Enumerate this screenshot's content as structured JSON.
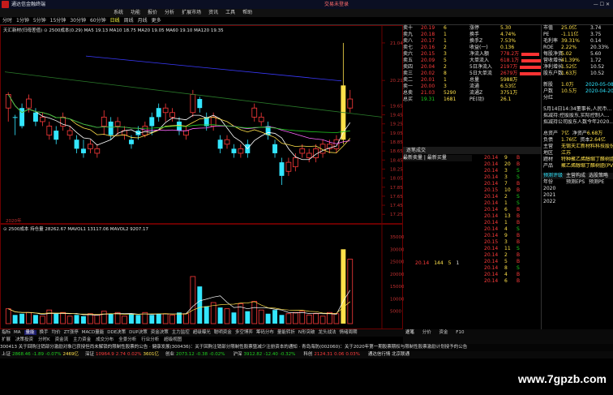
{
  "title": "通达信金融终端",
  "title_right": "交易未登录",
  "menu": [
    "系统",
    "功能",
    "报价",
    "分析",
    "扩展市场",
    "资讯",
    "工具",
    "帮助"
  ],
  "toolbar": [
    "分时",
    "1分钟",
    "5分钟",
    "15分钟",
    "30分钟",
    "60分钟",
    "日线",
    "周线",
    "月线",
    "更多"
  ],
  "toolbar_selected": "日线",
  "main_legend": "天汇新材(归母差值) ⊙ 2500成本(0.29)  MA5 19.13  MA10 18.75  MA20 19.05  MA60 19.10  MA120 19.35",
  "vol_legend": "⊙ 2500成本 持仓量 28262.67  MAVOL1 13117.06  MAVOL2 9207.17",
  "price_axis": [
    "21.04",
    "20.21",
    "19.65",
    "19.45",
    "19.25",
    "19.05",
    "18.85",
    "18.65",
    "18.45",
    "18.25",
    "18.05",
    "17.85",
    "17.65",
    "17.45",
    "17.25"
  ],
  "vol_axis": [
    "35000",
    "30000",
    "25000",
    "20000",
    "15000",
    "10000",
    "5000"
  ],
  "date_label": "2020年",
  "order_book": {
    "sells": [
      {
        "label": "卖十",
        "price": "20.19",
        "vol": "6"
      },
      {
        "label": "卖九",
        "price": "20.18",
        "vol": "1"
      },
      {
        "label": "卖八",
        "price": "20.17",
        "vol": "1"
      },
      {
        "label": "卖七",
        "price": "20.16",
        "vol": "2"
      },
      {
        "label": "卖六",
        "price": "20.15",
        "vol": "3"
      },
      {
        "label": "卖五",
        "price": "20.09",
        "vol": "5"
      },
      {
        "label": "卖四",
        "price": "20.04",
        "vol": "2"
      },
      {
        "label": "卖三",
        "price": "20.02",
        "vol": "8"
      },
      {
        "label": "卖二",
        "price": "20.01",
        "vol": "1"
      },
      {
        "label": "卖一",
        "price": "20.00",
        "vol": "3"
      }
    ],
    "totals": {
      "label": "总卖",
      "value": "21.03",
      "extra": "5290"
    },
    "buys_total": {
      "label": "总买",
      "value": "19.31",
      "extra": "1681"
    }
  },
  "stats": [
    {
      "k": "涨停",
      "v": "5.30"
    },
    {
      "k": "换手",
      "v": "4.74%"
    },
    {
      "k": "换手Z",
      "v": "7.53%"
    },
    {
      "k": "收益(一)",
      "v": "0.136"
    },
    {
      "k": "净流入额",
      "v": "778.2万"
    },
    {
      "k": "大单流入",
      "v": "618.1万"
    },
    {
      "k": "5日净流入",
      "v": "2197万"
    },
    {
      "k": "5日大单流",
      "v": "2679万"
    }
  ],
  "stats_right": [
    {
      "k": "总量",
      "v": "5988万"
    },
    {
      "k": "流通",
      "v": "6.53亿"
    },
    {
      "k": "流通Z",
      "v": "3751万"
    },
    {
      "k": "PE(动)",
      "v": "26.1"
    }
  ],
  "quote_panel": {
    "header": "逐笔成交",
    "ladder_header": "最新卖量 | 最新买量",
    "ladder_rows": [
      {
        "p": "20.14",
        "v": "9",
        "d": "B"
      },
      {
        "p": "20.14",
        "v": "20",
        "d": "B"
      },
      {
        "p": "20.14",
        "v": "3",
        "d": "S"
      },
      {
        "p": "20.14",
        "v": "3",
        "d": "S"
      },
      {
        "p": "20.14",
        "v": "7",
        "d": "B"
      },
      {
        "p": "20.15",
        "v": "10",
        "d": "B"
      },
      {
        "p": "20.14",
        "v": "2",
        "d": "S"
      },
      {
        "p": "20.14",
        "v": "1",
        "d": "S"
      },
      {
        "p": "20.14",
        "v": "6",
        "d": "B"
      },
      {
        "p": "20.14",
        "v": "13",
        "d": "B"
      },
      {
        "p": "20.14",
        "v": "1",
        "d": "B"
      },
      {
        "p": "20.14",
        "v": "4",
        "d": "S"
      },
      {
        "p": "20.14",
        "v": "9",
        "d": "B"
      },
      {
        "p": "20.15",
        "v": "3",
        "d": "B"
      },
      {
        "p": "20.14",
        "v": "11",
        "d": "S"
      },
      {
        "p": "20.14",
        "v": "2",
        "d": "B"
      },
      {
        "p": "20.14",
        "v": "5",
        "d": "B"
      },
      {
        "p": "20.14",
        "v": "8",
        "d": "S"
      },
      {
        "p": "20.14",
        "v": "4",
        "d": "B"
      },
      {
        "p": "20.14",
        "v": "6",
        "d": "B"
      }
    ],
    "buy_sell_row": {
      "b": "20.14",
      "v1": "144",
      "v2": "5",
      "extra": "1"
    }
  },
  "fundamentals": [
    {
      "k": "市值",
      "v": "25.0亿",
      "k2": "股本",
      "v2": "3.74"
    },
    {
      "k": "PE",
      "v": "-1.11亿",
      "k2": "流通",
      "v2": "3.75"
    },
    {
      "k": "毛利率",
      "v": "39.31%",
      "k2": "净利",
      "v2": "0.14"
    },
    {
      "k": "ROE",
      "v": "2.22%",
      "k2": "负债",
      "v2": "20.33%"
    },
    {
      "k": "每股净资",
      "v": "5.02",
      "k2": "",
      "v2": "5.60"
    },
    {
      "k": "营收增长",
      "v": "41.39%",
      "k2": "",
      "v2": "1.72"
    },
    {
      "k": "净利增长",
      "v": "1.52亿",
      "k2": "",
      "v2": "10.52"
    },
    {
      "k": "股东户数",
      "v": "1.63万",
      "k2": "",
      "v2": "10.52"
    }
  ],
  "events": {
    "dates": [
      "2020-05-08",
      "2020-04-20"
    ],
    "items": [
      "新股",
      "户数",
      "分红"
    ],
    "vals": [
      "1.0万",
      "10.5万"
    ]
  },
  "notes": [
    "5月14日14:34董事长,人民币...",
    "拟减持:控股股东,实际控制人...",
    "拟减持公司股东人数今年2020..."
  ],
  "financial": {
    "rows": [
      {
        "k": "总资产",
        "v": "7亿",
        "k2": "净资产",
        "v2": "6.68万"
      },
      {
        "k": "负债",
        "v": "1.76亿",
        "k2": "资本",
        "v2": "2.64亿"
      },
      {
        "k": "主营",
        "v": "无锡天汇新材料科技股份..."
      },
      {
        "k": "地区",
        "v": "江苏"
      },
      {
        "k": "题材",
        "v": "特种聚乙烯醇缩丁醛树脂..."
      },
      {
        "k": "产品",
        "v": "聚乙烯醇缩丁醛树脂(PVB)..."
      }
    ],
    "tabs": [
      "预测评级",
      "主营构成",
      "选股策略"
    ],
    "years_header": [
      "年份",
      "预测EPS",
      "预测PE"
    ],
    "years": [
      "2020",
      "2021",
      "2022"
    ]
  },
  "tabs_bottom": [
    "指标",
    "MA",
    "量能",
    "换手",
    "均价",
    "ZT涨停",
    "MACD量能",
    "DDE决策",
    "DUP决策",
    "资金决策",
    "主力监控",
    "超级曝光",
    "聪明资金",
    "多空博弈",
    "筹码分布",
    "量能转折",
    "N形突破",
    "龙头战法",
    "情绪周期"
  ],
  "tabs_bottom_selected": "量能",
  "tabs2": [
    "扩展",
    "决策投资",
    "分时K",
    "资金流",
    "主力资金",
    "成交分布",
    "全景分析",
    "行业分析",
    "超级视图"
  ],
  "news": "300413  关于回购注销部分激励对象已获授但尚未解锁的限制性股票的公告  ·  健康发展(300436)：关于回购注销部分限制性股票暨减少注册资本的通知  ·  青岛海防(002060)：关于2020年第一期股票期权与限制性股票激励计划授予的公告",
  "status": [
    {
      "k": "上证",
      "v": "2868.46",
      "c": "-1.89",
      "p": "-0.07%",
      "a": "2469亿",
      "cls": "grn"
    },
    {
      "k": "深证",
      "v": "10964.9",
      "c": "2.74",
      "p": "0.02%",
      "a": "3601亿",
      "cls": "red"
    },
    {
      "k": "创业",
      "v": "2073.12",
      "c": "-0.38",
      "p": "-0.02%",
      "a": "",
      "cls": "grn"
    },
    {
      "k": "沪深",
      "v": "3912.82",
      "c": "-12.40",
      "p": "-0.32%",
      "a": "",
      "cls": "grn"
    },
    {
      "k": "科创",
      "v": "2124.31",
      "c": "0.06",
      "p": "0.03%",
      "a": "",
      "cls": "red"
    }
  ],
  "status_tail": "通达信行情 北京联通",
  "watermark": "www.7gpzb.com",
  "candles": [
    [
      19.6,
      19.9,
      19.3,
      19.95,
      "u"
    ],
    [
      19.4,
      19.4,
      19.0,
      19.45,
      "d"
    ],
    [
      19.6,
      19.2,
      19.15,
      19.7,
      "d"
    ],
    [
      19.6,
      19.8,
      19.5,
      19.9,
      "u"
    ],
    [
      19.5,
      19.3,
      19.2,
      19.6,
      "d"
    ],
    [
      19.3,
      19.4,
      19.2,
      19.5,
      "u"
    ],
    [
      19.0,
      19.2,
      18.9,
      19.3,
      "u"
    ],
    [
      19.1,
      18.9,
      18.8,
      19.2,
      "d"
    ],
    [
      19.2,
      19.4,
      19.1,
      19.5,
      "u"
    ],
    [
      19.0,
      19.1,
      18.9,
      19.2,
      "u"
    ],
    [
      18.9,
      18.7,
      18.6,
      19.0,
      "d"
    ],
    [
      18.7,
      18.6,
      18.5,
      18.9,
      "d"
    ],
    [
      18.7,
      18.8,
      18.6,
      18.9,
      "u"
    ],
    [
      18.6,
      18.7,
      18.5,
      18.8,
      "u"
    ],
    [
      19.2,
      19.4,
      19.0,
      19.55,
      "u"
    ],
    [
      19.3,
      19.0,
      18.9,
      19.4,
      "d"
    ],
    [
      19.2,
      19.3,
      19.0,
      19.4,
      "u"
    ],
    [
      19.0,
      19.1,
      18.9,
      19.2,
      "u"
    ],
    [
      18.9,
      18.8,
      18.7,
      19.0,
      "d"
    ],
    [
      19.1,
      19.0,
      18.9,
      19.2,
      "d"
    ],
    [
      19.0,
      19.2,
      18.95,
      19.3,
      "u"
    ],
    [
      19.4,
      19.2,
      19.0,
      19.5,
      "d"
    ],
    [
      19.6,
      19.4,
      19.3,
      19.7,
      "d"
    ],
    [
      19.5,
      19.6,
      19.3,
      19.7,
      "u"
    ],
    [
      19.4,
      19.5,
      19.3,
      19.6,
      "u"
    ],
    [
      19.3,
      19.1,
      19.0,
      19.4,
      "d"
    ],
    [
      19.0,
      19.1,
      18.9,
      19.2,
      "u"
    ],
    [
      19.5,
      19.9,
      19.4,
      20.0,
      "u"
    ],
    [
      19.8,
      19.6,
      19.5,
      19.85,
      "d"
    ],
    [
      19.4,
      19.2,
      19.1,
      19.5,
      "d"
    ],
    [
      19.2,
      19.4,
      19.1,
      19.5,
      "u"
    ],
    [
      18.9,
      18.7,
      18.6,
      19.0,
      "d"
    ],
    [
      18.8,
      18.9,
      18.7,
      19.0,
      "u"
    ],
    [
      18.7,
      18.6,
      18.5,
      18.8,
      "d"
    ],
    [
      18.6,
      18.7,
      18.5,
      18.8,
      "u"
    ],
    [
      18.8,
      18.6,
      18.5,
      18.9,
      "d"
    ],
    [
      19.4,
      19.6,
      19.3,
      19.7,
      "u"
    ],
    [
      19.3,
      19.4,
      19.2,
      19.5,
      "u"
    ],
    [
      19.2,
      19.0,
      18.9,
      19.3,
      "d"
    ],
    [
      18.8,
      18.6,
      18.5,
      18.9,
      "d"
    ],
    [
      18.4,
      18.1,
      17.9,
      18.5,
      "d"
    ],
    [
      18.2,
      18.4,
      18.1,
      18.5,
      "u"
    ],
    [
      18.3,
      18.5,
      18.2,
      18.6,
      "u"
    ],
    [
      18.6,
      18.7,
      18.5,
      18.8,
      "u"
    ],
    [
      18.5,
      18.6,
      18.4,
      18.7,
      "u"
    ],
    [
      18.5,
      18.7,
      18.4,
      18.8,
      "u"
    ],
    [
      18.6,
      18.8,
      18.5,
      18.9,
      "u"
    ],
    [
      18.7,
      18.8,
      18.6,
      18.9,
      "u"
    ],
    [
      18.7,
      18.9,
      18.6,
      19.0,
      "u"
    ],
    [
      18.9,
      20.1,
      18.8,
      21.04,
      "y"
    ],
    [
      19.6,
      19.8,
      19.5,
      20.0,
      "u"
    ]
  ],
  "volumes": [
    6000,
    3500,
    4000,
    4500,
    3500,
    3000,
    5500,
    4000,
    4500,
    3000,
    3500,
    3000,
    4000,
    3500,
    5000,
    4000,
    4500,
    3000,
    4000,
    3500,
    4500,
    3500,
    4000,
    4000,
    3500,
    4500,
    4000,
    19000,
    15000,
    7000,
    8500,
    6500,
    6000,
    4500,
    8000,
    5000,
    9000,
    5500,
    4000,
    5500,
    3500,
    4000,
    4500,
    5000,
    3500,
    4000,
    3000,
    4500,
    4000,
    30000,
    26000
  ]
}
